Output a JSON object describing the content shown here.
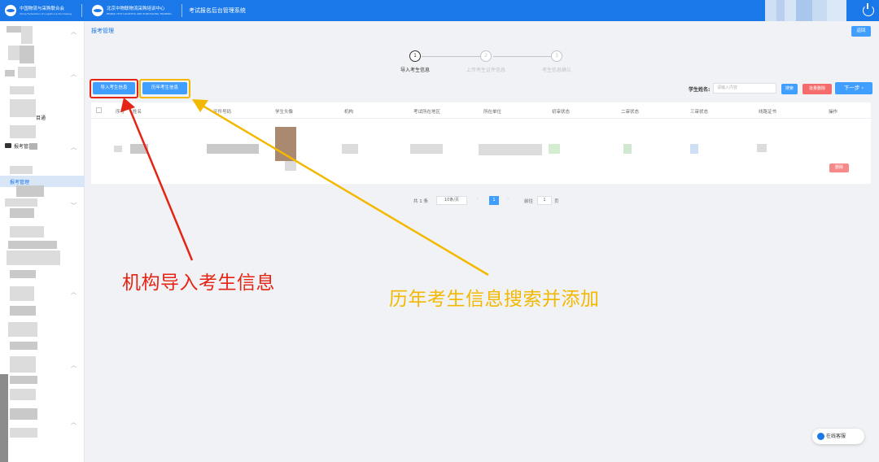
{
  "header": {
    "org1_name": "中国物流与采购联合会",
    "org1_sub": "China Federation of Logistics & Purchasing",
    "org2_name": "北京中物联物流采购培训中心",
    "org2_sub": "BEIJING CFLP LOGISTICS AND PURCHASING TRAINING CENTER",
    "system_title": "考试报名后台管理系统"
  },
  "sidebar": {
    "item_partial": "目通",
    "section_label": "报考管理",
    "active_item": "报考管理"
  },
  "breadcrumb": "报考管理",
  "back_button": "返回",
  "steps": [
    {
      "num": "1",
      "label": "导入考生信息",
      "state": "active"
    },
    {
      "num": "2",
      "label": "上传考生证件信息",
      "state": "inactive"
    },
    {
      "num": "3",
      "label": "考生信息确认",
      "state": "inactive"
    }
  ],
  "toolbar": {
    "import_btn": "导入考生信息",
    "history_btn": "历年考生信息",
    "search_label": "学生姓名:",
    "search_placeholder": "请输入内容",
    "search_btn": "搜索",
    "batch_delete_btn": "批量删除",
    "next_btn": "下一步 ›"
  },
  "table": {
    "headers": [
      "序号",
      "姓名",
      "证件号码",
      "学生头像",
      "机构",
      "考试所在地区",
      "所在单位",
      "初审状态",
      "二审状态",
      "三审状态",
      "线路证书",
      "操作"
    ],
    "row_action": "删除"
  },
  "pagination": {
    "total": "共 1 条",
    "page_size": "10条/页",
    "current": "1",
    "goto_label": "前往",
    "goto_value": "1",
    "page_unit": "页"
  },
  "annotations": {
    "red_text": "机构导入考生信息",
    "orange_text": "历年考生信息搜索并添加"
  },
  "chat_button": "在线客服",
  "colors": {
    "primary": "#1a78e8",
    "button": "#409eff",
    "danger": "#f56c6c",
    "annotation_red": "#e42515",
    "annotation_orange": "#f3b800"
  }
}
